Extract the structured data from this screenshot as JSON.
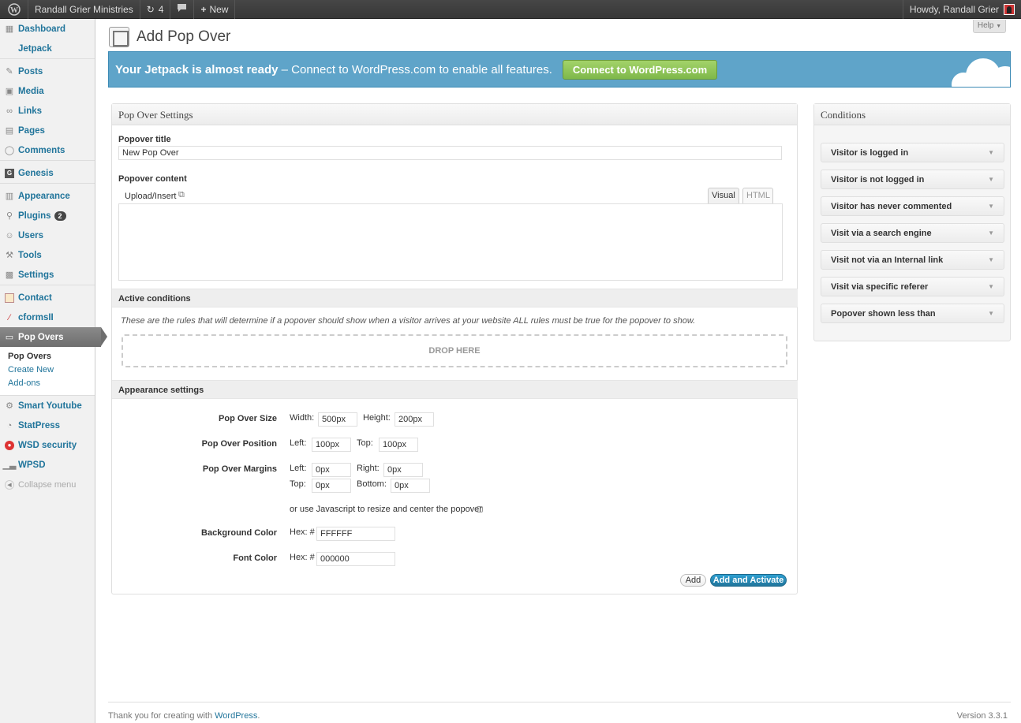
{
  "adminbar": {
    "site_name": "Randall Grier Ministries",
    "updates_count": "4",
    "new_label": "New",
    "howdy": "Howdy, Randall Grier"
  },
  "sidebar": {
    "items": [
      {
        "label": "Dashboard",
        "icon": "dashboard-icon"
      },
      {
        "label": "Jetpack",
        "icon": "jetpack-icon"
      },
      {
        "label": "Posts",
        "icon": "pin-icon"
      },
      {
        "label": "Media",
        "icon": "media-icon"
      },
      {
        "label": "Links",
        "icon": "link-icon"
      },
      {
        "label": "Pages",
        "icon": "page-icon"
      },
      {
        "label": "Comments",
        "icon": "comment-icon"
      },
      {
        "label": "Genesis",
        "icon": "genesis-icon"
      },
      {
        "label": "Appearance",
        "icon": "appearance-icon"
      },
      {
        "label": "Plugins",
        "icon": "plugin-icon",
        "badge": "2"
      },
      {
        "label": "Users",
        "icon": "users-icon"
      },
      {
        "label": "Tools",
        "icon": "tools-icon"
      },
      {
        "label": "Settings",
        "icon": "settings-icon"
      },
      {
        "label": "Contact",
        "icon": "contact-icon"
      },
      {
        "label": "cformsII",
        "icon": "cforms-icon"
      },
      {
        "label": "Pop Overs",
        "icon": "popover-icon"
      },
      {
        "label": "Smart Youtube",
        "icon": "youtube-icon"
      },
      {
        "label": "StatPress",
        "icon": "statpress-icon"
      },
      {
        "label": "WSD security",
        "icon": "security-icon"
      },
      {
        "label": "WPSD",
        "icon": "chart-icon"
      }
    ],
    "submenu": [
      "Pop Overs",
      "Create New",
      "Add-ons"
    ],
    "collapse": "Collapse menu"
  },
  "page": {
    "title": "Add Pop Over",
    "help": "Help"
  },
  "jetpack": {
    "bold": "Your Jetpack is almost ready",
    "rest": " – Connect to WordPress.com to enable all features.",
    "button": "Connect to WordPress.com"
  },
  "settings": {
    "heading": "Pop Over Settings",
    "title_label": "Popover title",
    "title_value": "New Pop Over",
    "content_label": "Popover content",
    "upload_label": "Upload/Insert",
    "tab_visual": "Visual",
    "tab_html": "HTML",
    "active_conditions": "Active conditions",
    "rules_text": "These are the rules that will determine if a popover should show when a visitor arrives at your website ALL rules must be true for the popover to show.",
    "drop_here": "DROP HERE",
    "appearance": "Appearance settings",
    "size_label": "Pop Over Size",
    "width_label": "Width:",
    "width": "500px",
    "height_label": "Height:",
    "height": "200px",
    "position_label": "Pop Over Position",
    "left_label": "Left:",
    "pos_left": "100px",
    "top_label": "Top:",
    "pos_top": "100px",
    "margins_label": "Pop Over Margins",
    "m_left": "0px",
    "right_label": "Right:",
    "m_right": "0px",
    "m_top": "0px",
    "bottom_label": "Bottom:",
    "m_bottom": "0px",
    "js_text": "or use Javascript to resize and center the popover",
    "bg_label": "Background Color",
    "hex_label": "Hex: #",
    "bg": "FFFFFF",
    "font_label": "Font Color",
    "font": "000000",
    "add": "Add",
    "add_activate": "Add and Activate"
  },
  "conditions": {
    "heading": "Conditions",
    "items": [
      "Visitor is logged in",
      "Visitor is not logged in",
      "Visitor has never commented",
      "Visit via a search engine",
      "Visit not via an Internal link",
      "Visit via specific referer",
      "Popover shown less than"
    ]
  },
  "footer": {
    "thanks": "Thank you for creating with ",
    "link": "WordPress",
    "period": ".",
    "version": "Version 3.3.1"
  },
  "colors": {
    "link": "#21759b",
    "jetpack_bg": "#5fa4c9",
    "jetpack_button": "#8cc25a"
  }
}
